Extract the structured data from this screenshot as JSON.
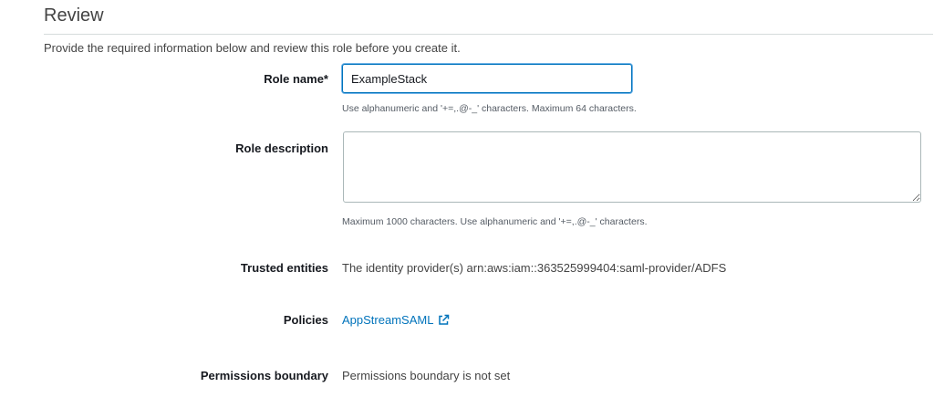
{
  "page": {
    "title": "Review",
    "intro": "Provide the required information below and review this role before you create it."
  },
  "role_name": {
    "label": "Role name*",
    "value": "ExampleStack",
    "hint": "Use alphanumeric and '+=,.@-_' characters. Maximum 64 characters."
  },
  "role_description": {
    "label": "Role description",
    "value": "",
    "hint": "Maximum 1000 characters. Use alphanumeric and '+=,.@-_' characters."
  },
  "trusted_entities": {
    "label": "Trusted entities",
    "value": "The identity provider(s) arn:aws:iam::363525999404:saml-provider/ADFS"
  },
  "policies": {
    "label": "Policies",
    "link_text": "AppStreamSAML",
    "icon": "external-link-icon",
    "link_color": "#0073bb"
  },
  "permissions_boundary": {
    "label": "Permissions boundary",
    "value": "Permissions boundary is not set"
  }
}
